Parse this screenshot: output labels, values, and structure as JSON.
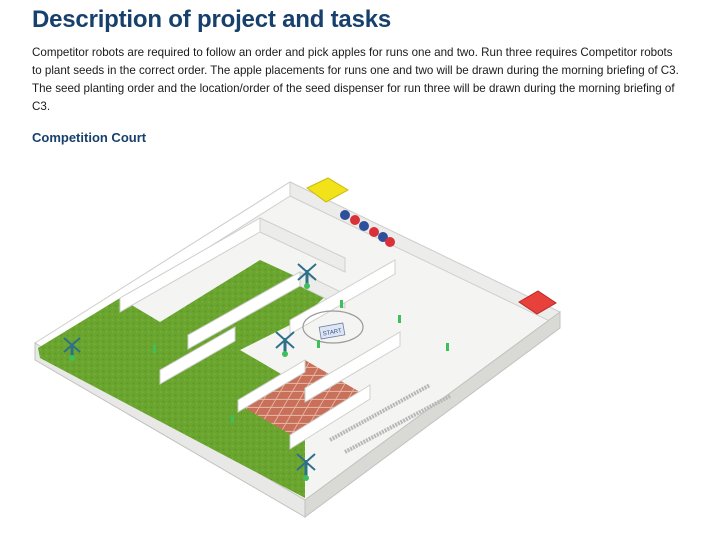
{
  "document": {
    "title": "Description of project and tasks",
    "body": "Competitor robots are required to follow an order and pick apples for runs one and two. Run three requires Competitor robots to plant seeds in the correct order. The apple placements for runs one and two will be drawn during the morning briefing of C3. The seed planting order and the location/order of the seed dispenser for run three will be drawn during the morning briefing of C3.",
    "section_heading": "Competition Court"
  },
  "figure": {
    "sign_text": "START",
    "colors": {
      "grass": "#6aa52f",
      "grass_dark": "#4f8a22",
      "floor": "#f4f4f2",
      "wall_light": "#ffffff",
      "wall_shade": "#d9d9d6",
      "brick": "#c8705a",
      "yellow_zone": "#f2e21a",
      "red_zone": "#e8403a",
      "tree": "#2e6f8a",
      "marker": "#3fbf5a",
      "apple_red": "#d9303a",
      "apple_blue": "#2e4f9a"
    }
  }
}
